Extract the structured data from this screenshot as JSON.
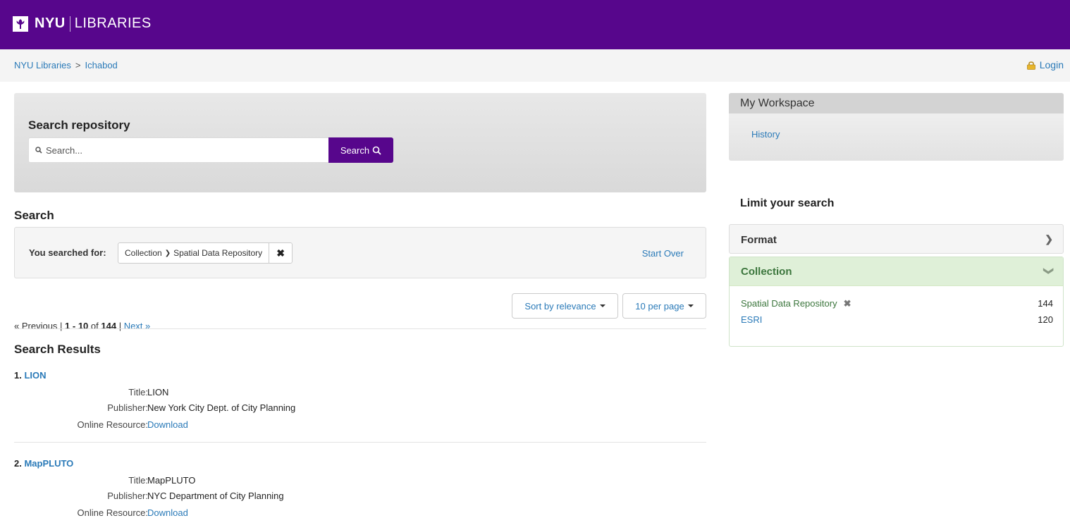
{
  "header": {
    "brand_bold": "NYU",
    "brand_light": "LIBRARIES"
  },
  "breadcrumb": {
    "home": "NYU Libraries",
    "separator": ">",
    "current": "Ichabod"
  },
  "login": {
    "label": "Login"
  },
  "search_box": {
    "heading": "Search repository",
    "placeholder": "Search...",
    "button": "Search"
  },
  "constraints": {
    "heading": "Search",
    "label": "You searched for:",
    "facet_field": "Collection",
    "facet_value": "Spatial Data Repository",
    "start_over": "Start Over"
  },
  "pagination": {
    "previous": "« Previous",
    "range": "1 - 10",
    "of": "of",
    "total": "144",
    "next": "Next »",
    "sort_label": "Sort by relevance",
    "per_page_label": "10 per page"
  },
  "results": {
    "heading": "Search Results",
    "items": [
      {
        "number": "1.",
        "title_link": "LION",
        "fields": [
          {
            "key": "Title:",
            "value": "LION"
          },
          {
            "key": "Publisher:",
            "value": "New York City Dept. of City Planning"
          },
          {
            "key": "Online Resource:",
            "value": "Download"
          }
        ]
      },
      {
        "number": "2.",
        "title_link": "MapPLUTO",
        "fields": [
          {
            "key": "Title:",
            "value": "MapPLUTO"
          },
          {
            "key": "Publisher:",
            "value": "NYC Department of City Planning"
          },
          {
            "key": "Online Resource:",
            "value": "Download"
          }
        ]
      }
    ]
  },
  "sidebar": {
    "workspace": {
      "heading": "My Workspace",
      "history": "History"
    },
    "limit_heading": "Limit your search",
    "facets": {
      "format": {
        "label": "Format"
      },
      "collection": {
        "label": "Collection",
        "values": [
          {
            "label": "Spatial Data Repository",
            "count": "144",
            "selected": true
          },
          {
            "label": "ESRI",
            "count": "120",
            "selected": false
          }
        ]
      }
    }
  },
  "colors": {
    "brand_purple": "#57068c",
    "link_blue": "#2a7ab8",
    "facet_green": "#3c763d"
  }
}
